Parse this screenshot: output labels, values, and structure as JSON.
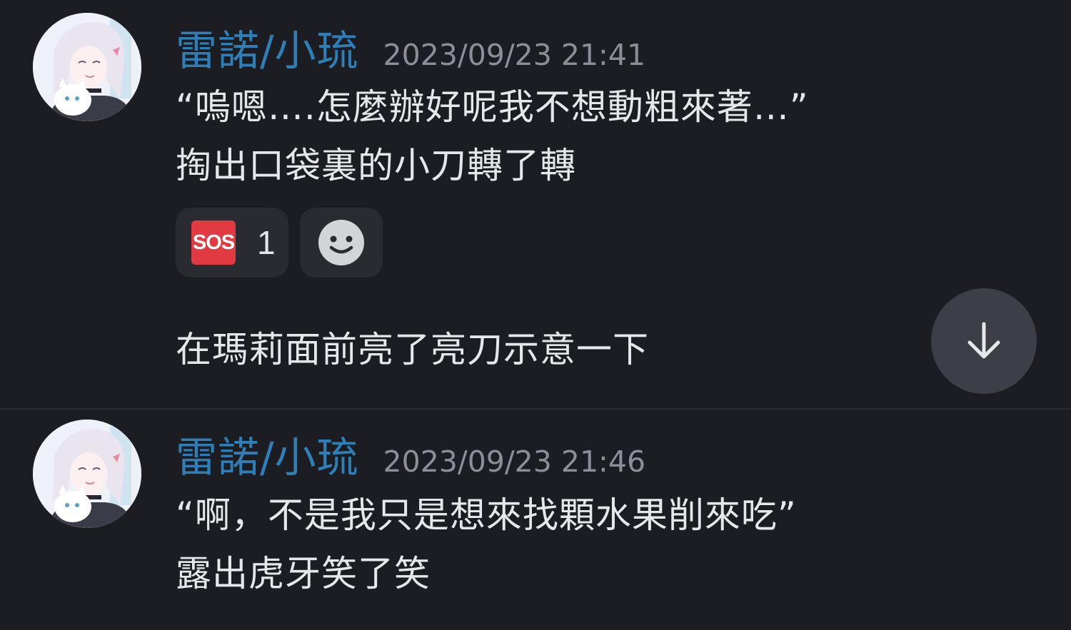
{
  "messages": [
    {
      "author": "雷諾/小琉",
      "timestamp": "2023/09/23 21:41",
      "lines": [
        "“嗚嗯….怎麼辦好呢我不想動粗來著…”",
        "掏出口袋裏的小刀轉了轉"
      ],
      "reactions": [
        {
          "emoji_text": "SOS",
          "emoji_icon": "sos-emoji",
          "count": "1"
        }
      ],
      "add_reaction_icon": "smiley-face-icon",
      "followup_lines": [
        "在瑪莉面前亮了亮刀示意一下"
      ]
    },
    {
      "author": "雷諾/小琉",
      "timestamp": "2023/09/23 21:46",
      "lines": [
        "“啊，不是我只是想來找顆水果削來吃”",
        "露出虎牙笑了笑"
      ]
    }
  ],
  "scroll_button_icon": "arrow-down-icon",
  "colors": {
    "background": "#1c1d22",
    "author_name": "#2e7fb8",
    "timestamp": "#8c8f98",
    "message_text": "#e6e7ea",
    "reaction_bg": "#2a2b31",
    "sos_red": "#e23a42",
    "scroll_button_bg": "#3d3f46"
  }
}
